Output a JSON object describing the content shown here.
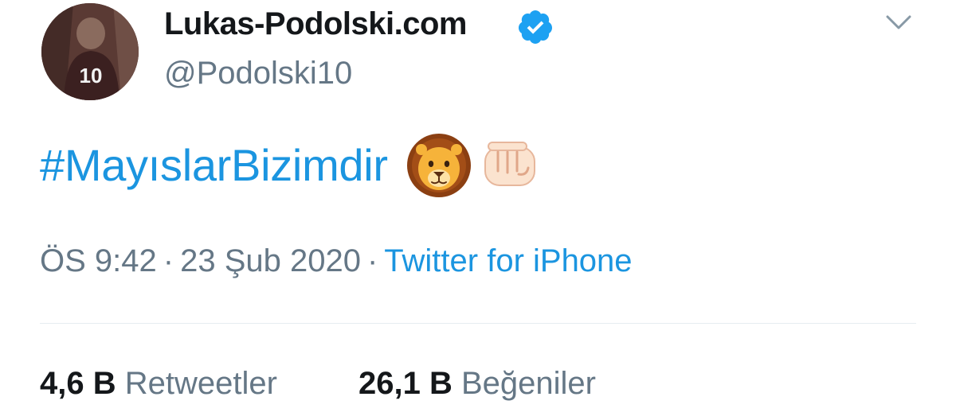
{
  "tweet": {
    "author": {
      "display_name": "Lukas-Podolski.com",
      "handle": "@Podolski10",
      "verified": true,
      "avatar_jersey_number": "10"
    },
    "text": {
      "hashtag": "#MayıslarBizimdir",
      "emojis": [
        "lion-face-emoji",
        "oncoming-fist-emoji"
      ]
    },
    "meta": {
      "time": "ÖS 9:42",
      "separator": "·",
      "date": "23 Şub 2020",
      "source": "Twitter for iPhone"
    },
    "stats": {
      "retweets_count": "4,6 B",
      "retweets_label": "Retweetler",
      "likes_count": "26,1 B",
      "likes_label": "Beğeniler"
    }
  },
  "colors": {
    "link": "#1b95e0",
    "text_primary": "#14171a",
    "text_secondary": "#657786",
    "verified": "#1da1f2",
    "divider": "#e6ecf0"
  },
  "icons": {
    "verified": "verified-badge-icon",
    "menu": "chevron-down-icon"
  }
}
